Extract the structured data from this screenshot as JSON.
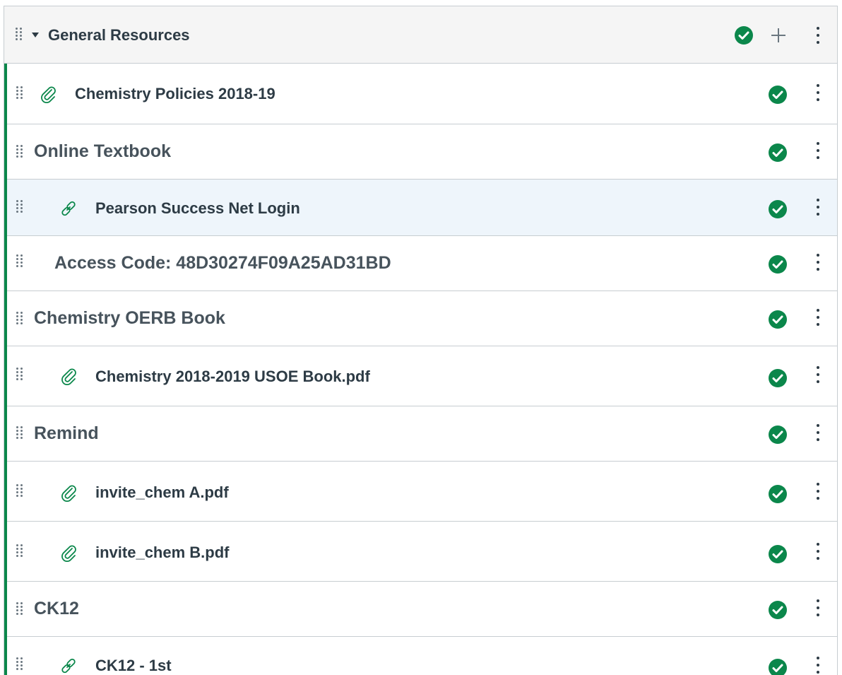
{
  "module": {
    "title": "General Resources",
    "items": [
      {
        "title": "Chemistry Policies 2018-19",
        "type": "attachment",
        "kind": "item",
        "indent": 0
      },
      {
        "title": "Online Textbook",
        "type": "subheader",
        "kind": "subheader",
        "indent": 0
      },
      {
        "title": "Pearson Success Net Login",
        "type": "link",
        "kind": "item",
        "indent": 1,
        "highlighted": true
      },
      {
        "title": "Access Code: 48D30274F09A25AD31BD",
        "type": "text",
        "kind": "subheader",
        "indent": 1
      },
      {
        "title": "Chemistry OERB Book",
        "type": "subheader",
        "kind": "subheader",
        "indent": 0
      },
      {
        "title": "Chemistry 2018-2019 USOE Book.pdf",
        "type": "attachment",
        "kind": "item",
        "indent": 1
      },
      {
        "title": "Remind",
        "type": "subheader",
        "kind": "subheader",
        "indent": 0
      },
      {
        "title": "invite_chem A.pdf",
        "type": "attachment",
        "kind": "item",
        "indent": 1
      },
      {
        "title": "invite_chem B.pdf",
        "type": "attachment",
        "kind": "item",
        "indent": 1
      },
      {
        "title": "CK12",
        "type": "subheader",
        "kind": "subheader",
        "indent": 0
      },
      {
        "title": "CK12 - 1st",
        "type": "link",
        "kind": "item",
        "indent": 1
      }
    ]
  },
  "icons": {
    "drag": "drag-handle-icon",
    "collapse": "caret-down-icon",
    "published": "published-check-icon",
    "add": "plus-icon",
    "menu": "kebab-menu-icon",
    "attachment": "paperclip-icon",
    "link": "link-icon"
  },
  "colors": {
    "published_green": "#0b874b",
    "header_bg": "#f5f5f5",
    "highlight_bg": "#eef5fb",
    "text": "#2d3b45",
    "border": "#c7cdd1"
  }
}
